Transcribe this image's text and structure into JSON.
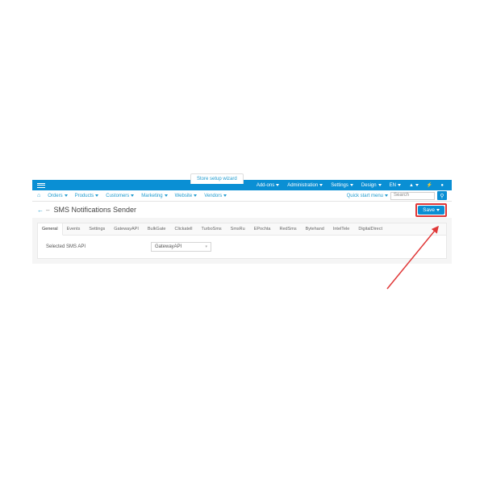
{
  "wizard": "Store setup wizard",
  "topnav": {
    "addons": "Add-ons",
    "admin": "Administration",
    "settings": "Settings",
    "design": "Design",
    "lang": "EN"
  },
  "menubar": {
    "orders": "Orders",
    "products": "Products",
    "customers": "Customers",
    "marketing": "Marketing",
    "website": "Website",
    "vendors": "Vendors",
    "quick": "Quick start menu",
    "search_ph": "Search"
  },
  "page": {
    "title": "SMS Notifications Sender",
    "save": "Save"
  },
  "tabs": [
    "General",
    "Events",
    "Settings",
    "GatewayAPI",
    "BulkGate",
    "Clickatell",
    "TurboSms",
    "SmsRu",
    "EPochta",
    "RedSms",
    "Bytehand",
    "IntelTele",
    "DigitalDirect"
  ],
  "form": {
    "label": "Selected SMS API",
    "value": "GatewayAPI"
  }
}
